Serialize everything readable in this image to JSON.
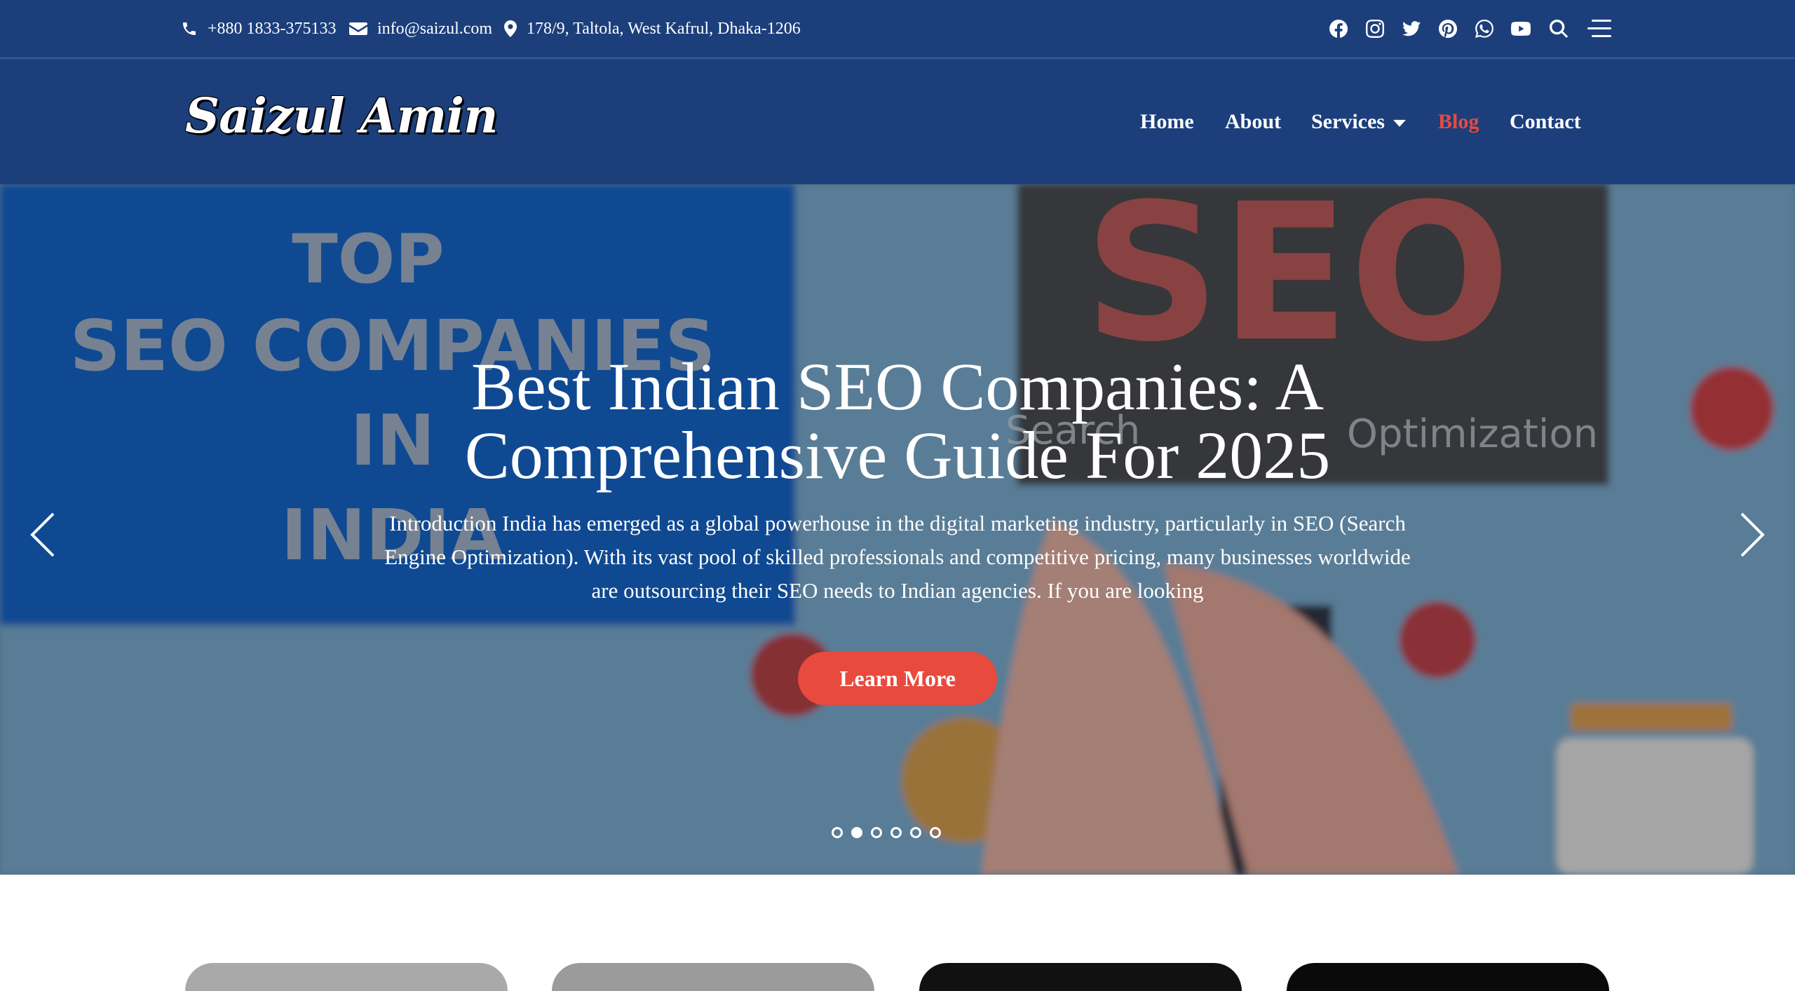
{
  "topbar": {
    "phone": "+880 1833-375133",
    "email": "info@saizul.com",
    "address": "178/9, Taltola, West Kafrul, Dhaka-1206",
    "social_icons": [
      "facebook-icon",
      "instagram-icon",
      "twitter-icon",
      "pinterest-icon",
      "whatsapp-icon",
      "youtube-icon",
      "search-icon",
      "menu-icon"
    ]
  },
  "header": {
    "logo": "Saizul Amin",
    "nav": [
      {
        "label": "Home"
      },
      {
        "label": "About"
      },
      {
        "label": "Services"
      },
      {
        "label": "Blog"
      },
      {
        "label": "Contact"
      }
    ]
  },
  "hero": {
    "title_line1": "Best Indian SEO Companies: A",
    "title_line2": "Comprehensive Guide For 2025",
    "desc_line1": "Introduction India has emerged as a global powerhouse in the digital marketing industry, particularly in SEO (Search",
    "desc_line2": "Engine Optimization). With its vast pool of skilled professionals and competitive pricing, many businesses worldwide",
    "desc_line3": "are outsourcing their SEO needs to Indian agencies. If you are looking",
    "button": "Learn More",
    "bg_text_top": "TOP",
    "bg_text_seo_companies": "SEO COMPANIES",
    "bg_text_in": "IN",
    "bg_text_india": "INDIA",
    "bg_text_seo": "SEO",
    "bg_text_search": "Search",
    "bg_text_optimization": "Optimization",
    "slides_total": 6,
    "active_slide": 2
  },
  "colors": {
    "primary": "#1c3f7c",
    "accent": "#e84a3d"
  }
}
